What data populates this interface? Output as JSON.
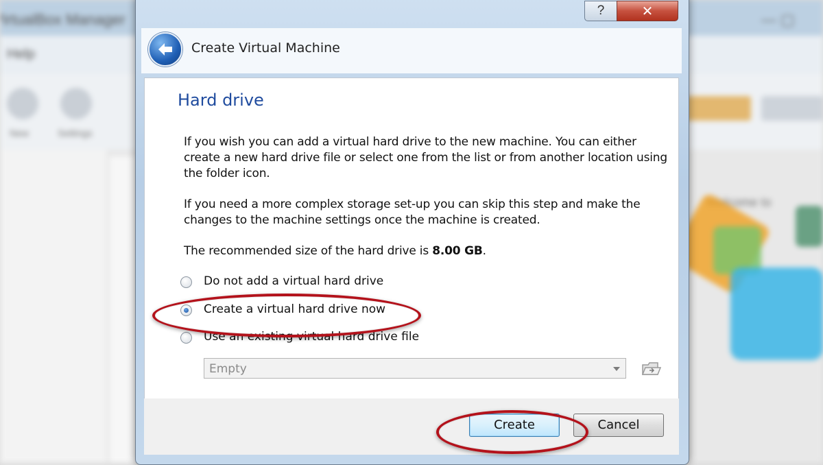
{
  "background_app": {
    "title_left": "VirtualBox Manager",
    "title_right": "— ▢",
    "menu": "Help",
    "toolbar_labels": [
      "New",
      "Settings"
    ],
    "right_text": "Welcome to"
  },
  "dialog": {
    "title": "Create Virtual Machine",
    "help_glyph": "?",
    "close_glyph": "✕",
    "section_title": "Hard drive",
    "paragraph1": "If you wish you can add a virtual hard drive to the new machine. You can either create a new hard drive file or select one from the list or from another location using the folder icon.",
    "paragraph2": "If you need a more complex storage set-up you can skip this step and make the changes to the machine settings once the machine is created.",
    "recommended_prefix": "The recommended size of the hard drive is ",
    "recommended_size": "8.00 GB",
    "recommended_suffix": ".",
    "options": [
      {
        "label": "Do not add a virtual hard drive",
        "checked": false
      },
      {
        "label": "Create a virtual hard drive now",
        "checked": true
      },
      {
        "label": "Use an existing virtual hard drive file",
        "checked": false
      }
    ],
    "existing_file_select": "Empty",
    "buttons": {
      "create": "Create",
      "cancel": "Cancel"
    }
  },
  "colors": {
    "section_title": "#1f4b9e",
    "highlight_ring": "#b3121b"
  }
}
